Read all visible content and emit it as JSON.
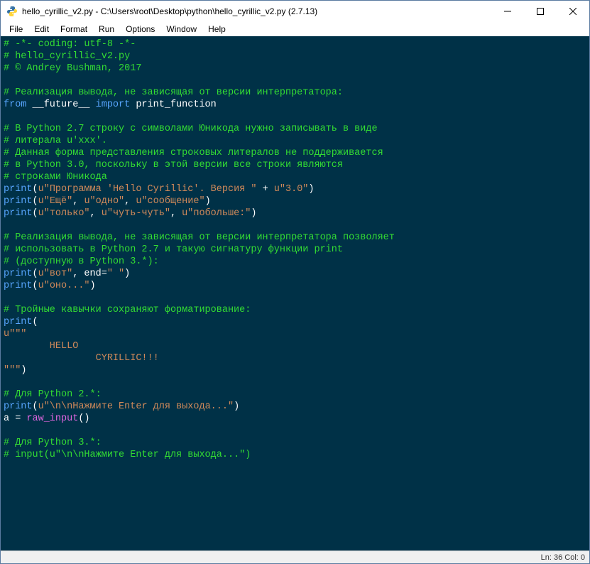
{
  "window": {
    "title": "hello_cyrillic_v2.py - C:\\Users\\root\\Desktop\\python\\hello_cyrillic_v2.py (2.7.13)"
  },
  "menu": {
    "file": "File",
    "edit": "Edit",
    "format": "Format",
    "run": "Run",
    "options": "Options",
    "window": "Window",
    "help": "Help"
  },
  "code": {
    "lines": [
      [
        {
          "c": "c-comment",
          "t": "# -*- coding: utf-8 -*-"
        }
      ],
      [
        {
          "c": "c-comment",
          "t": "# hello_cyrillic_v2.py"
        }
      ],
      [
        {
          "c": "c-comment",
          "t": "# © Andrey Bushman, 2017"
        }
      ],
      [],
      [
        {
          "c": "c-comment",
          "t": "# Реализация вывода, не зависящая от версии интерпретатора:"
        }
      ],
      [
        {
          "c": "c-kw",
          "t": "from"
        },
        {
          "c": "c-name",
          "t": " __future__ "
        },
        {
          "c": "c-kw",
          "t": "import"
        },
        {
          "c": "c-name",
          "t": " print_function"
        }
      ],
      [],
      [
        {
          "c": "c-comment",
          "t": "# В Python 2.7 строку с символами Юникода нужно записывать в виде"
        }
      ],
      [
        {
          "c": "c-comment",
          "t": "# литерала u'xxx'."
        }
      ],
      [
        {
          "c": "c-comment",
          "t": "# Данная форма представления строковых литералов не поддерживается"
        }
      ],
      [
        {
          "c": "c-comment",
          "t": "# в Python 3.0, поскольку в этой версии все строки являются"
        }
      ],
      [
        {
          "c": "c-comment",
          "t": "# строками Юникода"
        }
      ],
      [
        {
          "c": "c-builtin",
          "t": "print"
        },
        {
          "c": "c-op",
          "t": "("
        },
        {
          "c": "c-str",
          "t": "u\"Программа 'Hello Cyrillic'. Версия \""
        },
        {
          "c": "c-op",
          "t": " + "
        },
        {
          "c": "c-str",
          "t": "u\"3.0\""
        },
        {
          "c": "c-op",
          "t": ")"
        }
      ],
      [
        {
          "c": "c-builtin",
          "t": "print"
        },
        {
          "c": "c-op",
          "t": "("
        },
        {
          "c": "c-str",
          "t": "u\"Ещё\""
        },
        {
          "c": "c-op",
          "t": ", "
        },
        {
          "c": "c-str",
          "t": "u\"одно\""
        },
        {
          "c": "c-op",
          "t": ", "
        },
        {
          "c": "c-str",
          "t": "u\"сообщение\""
        },
        {
          "c": "c-op",
          "t": ")"
        }
      ],
      [
        {
          "c": "c-builtin",
          "t": "print"
        },
        {
          "c": "c-op",
          "t": "("
        },
        {
          "c": "c-str",
          "t": "u\"только\""
        },
        {
          "c": "c-op",
          "t": ", "
        },
        {
          "c": "c-str",
          "t": "u\"чуть-чуть\""
        },
        {
          "c": "c-op",
          "t": ", "
        },
        {
          "c": "c-str",
          "t": "u\"побольше:\""
        },
        {
          "c": "c-op",
          "t": ")"
        }
      ],
      [],
      [
        {
          "c": "c-comment",
          "t": "# Реализация вывода, не зависящая от версии интерпретатора позволяет"
        }
      ],
      [
        {
          "c": "c-comment",
          "t": "# использовать в Python 2.7 и такую сигнатуру функции print"
        }
      ],
      [
        {
          "c": "c-comment",
          "t": "# (доступную в Python 3.*):"
        }
      ],
      [
        {
          "c": "c-builtin",
          "t": "print"
        },
        {
          "c": "c-op",
          "t": "("
        },
        {
          "c": "c-str",
          "t": "u\"вот\""
        },
        {
          "c": "c-op",
          "t": ", end="
        },
        {
          "c": "c-str",
          "t": "\" \""
        },
        {
          "c": "c-op",
          "t": ")"
        }
      ],
      [
        {
          "c": "c-builtin",
          "t": "print"
        },
        {
          "c": "c-op",
          "t": "("
        },
        {
          "c": "c-str",
          "t": "u\"оно...\""
        },
        {
          "c": "c-op",
          "t": ")"
        }
      ],
      [],
      [
        {
          "c": "c-comment",
          "t": "# Тройные кавычки сохраняют форматирование:"
        }
      ],
      [
        {
          "c": "c-builtin",
          "t": "print"
        },
        {
          "c": "c-op",
          "t": "("
        }
      ],
      [
        {
          "c": "c-str",
          "t": "u\"\"\""
        }
      ],
      [
        {
          "c": "c-str",
          "t": "        HELLO"
        }
      ],
      [
        {
          "c": "c-str",
          "t": "                CYRILLIC!!!"
        }
      ],
      [
        {
          "c": "c-str",
          "t": "\"\"\""
        },
        {
          "c": "c-op",
          "t": ")"
        }
      ],
      [],
      [
        {
          "c": "c-comment",
          "t": "# Для Python 2.*:"
        }
      ],
      [
        {
          "c": "c-builtin",
          "t": "print"
        },
        {
          "c": "c-op",
          "t": "("
        },
        {
          "c": "c-str",
          "t": "u\"\\n\\nНажмите Enter для выхода...\""
        },
        {
          "c": "c-op",
          "t": ")"
        }
      ],
      [
        {
          "c": "c-name",
          "t": "a = "
        },
        {
          "c": "c-def",
          "t": "raw_input"
        },
        {
          "c": "c-op",
          "t": "()"
        }
      ],
      [],
      [
        {
          "c": "c-comment",
          "t": "# Для Python 3.*:"
        }
      ],
      [
        {
          "c": "c-comment",
          "t": "# input(u\"\\n\\nНажмите Enter для выхода...\")"
        }
      ]
    ]
  },
  "status": {
    "position": "Ln: 36  Col: 0"
  }
}
